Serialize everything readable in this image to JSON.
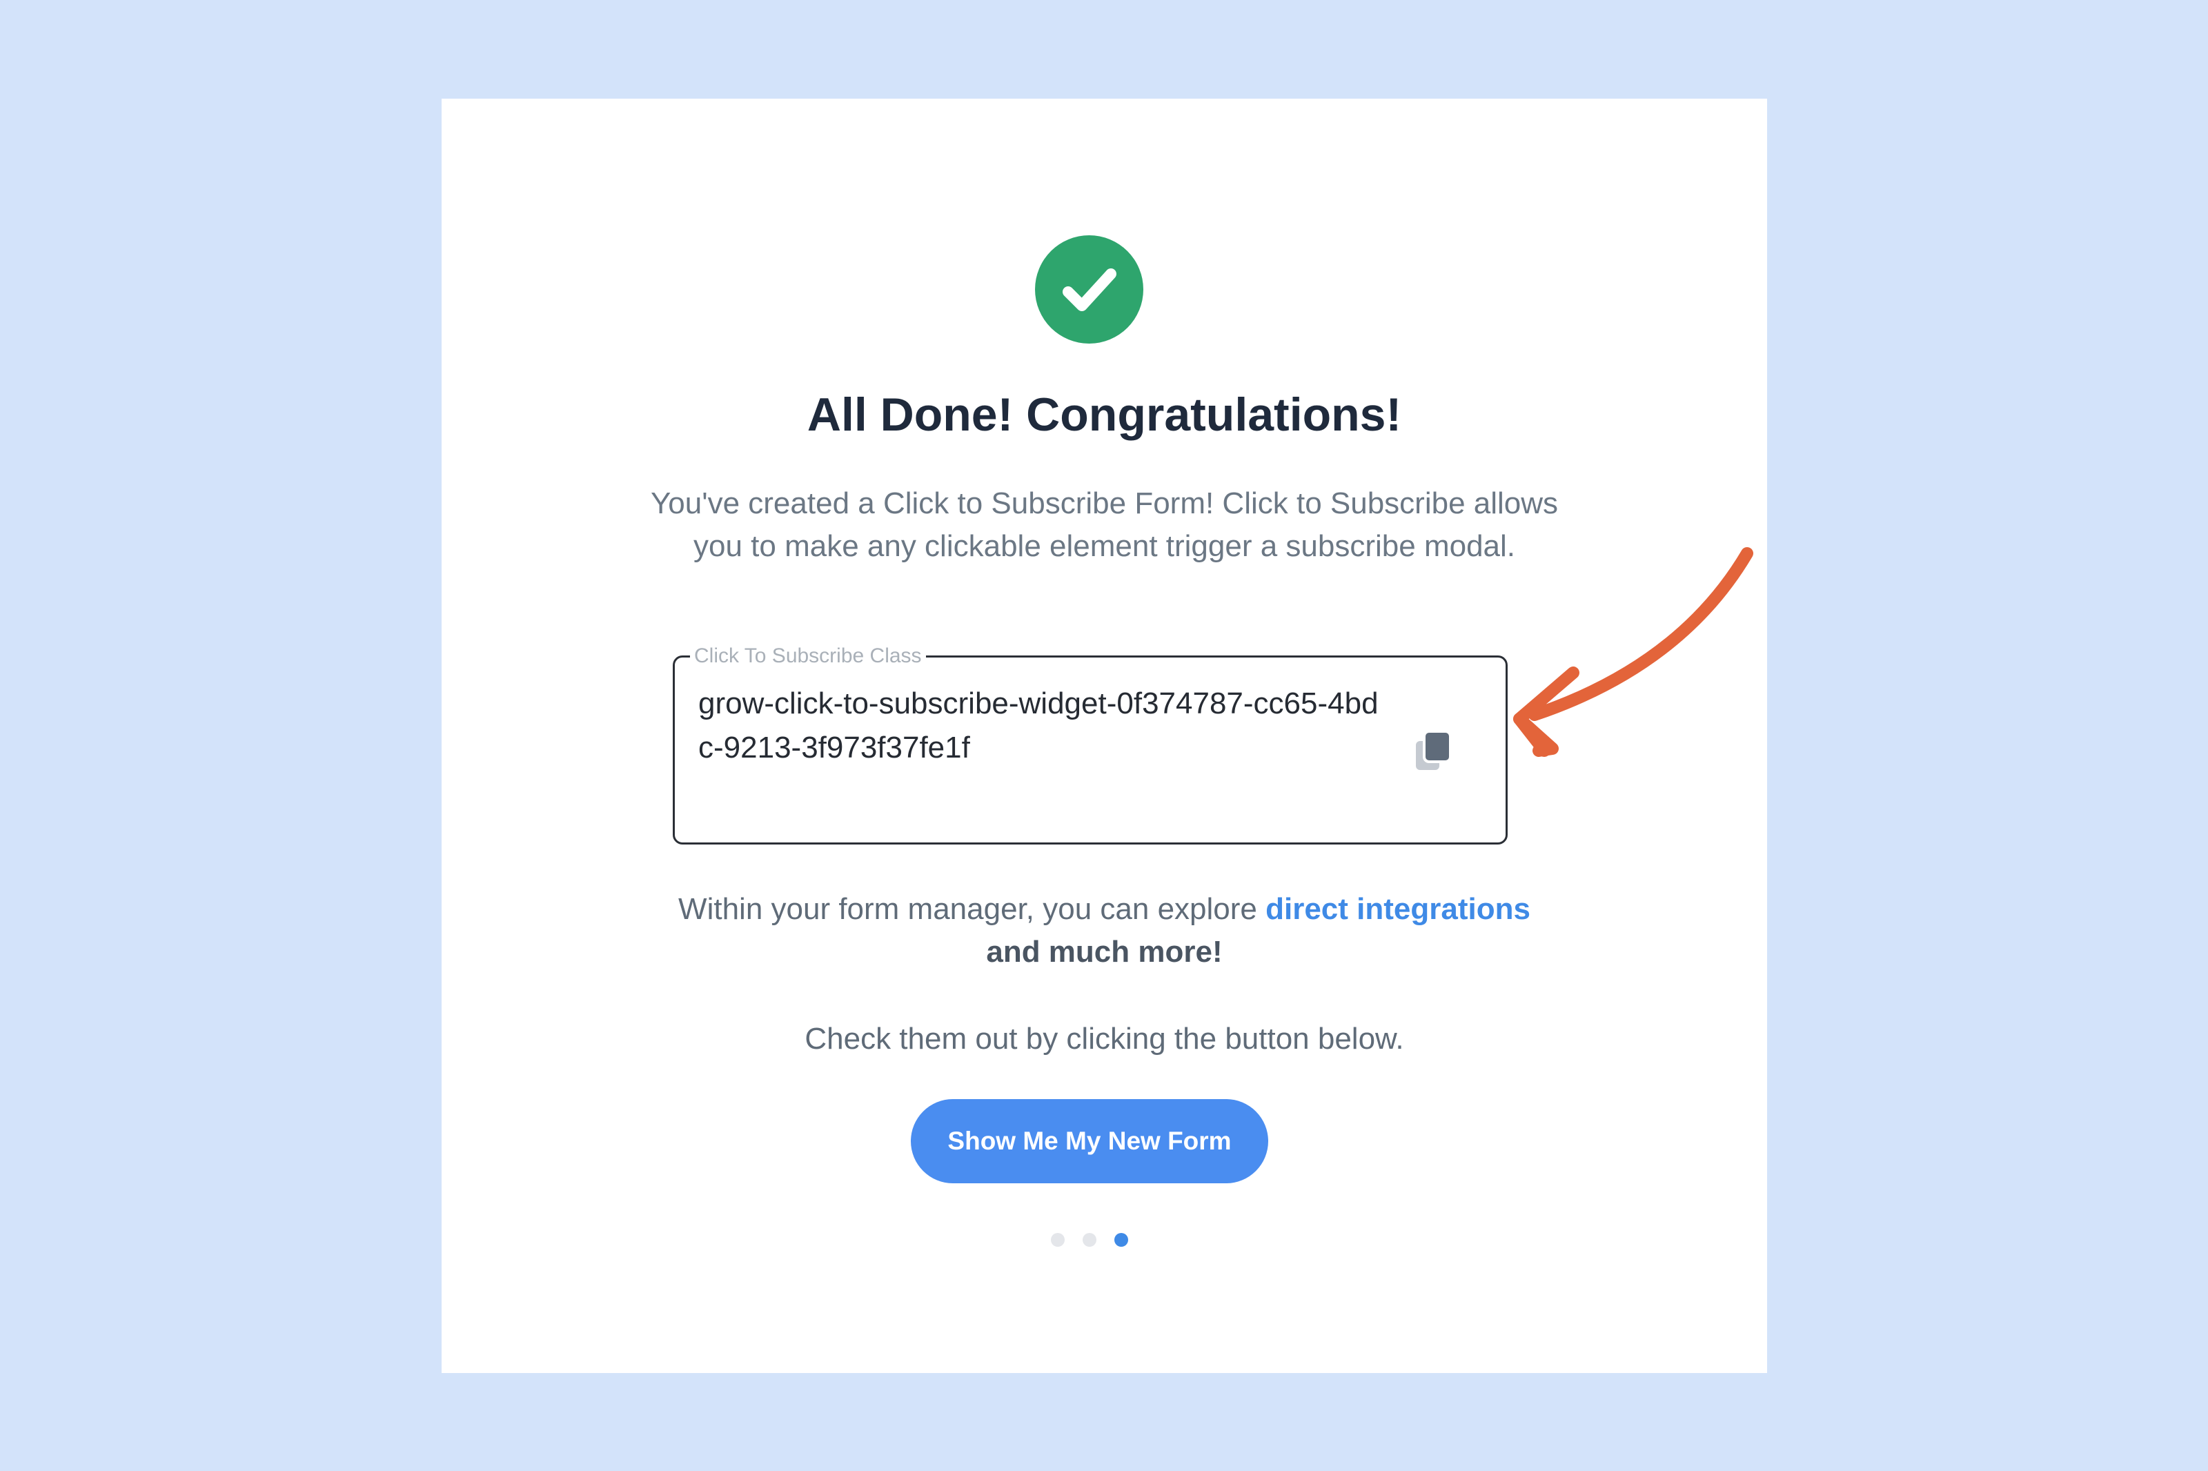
{
  "card": {
    "title": "All Done! Congratulations!",
    "description": "You've created a Click to Subscribe Form! Click to Subscribe allows you to make any clickable element trigger a subscribe modal.",
    "field": {
      "label": "Click To Subscribe Class",
      "value": "grow-click-to-subscribe-widget-0f374787-cc65-4bdc-9213-3f973f37fe1f",
      "copy_icon": "copy-icon"
    },
    "explore": {
      "prefix": "Within your form manager, you can explore ",
      "link": "direct integrations",
      "suffix": " and much more!"
    },
    "check_text": "Check them out by clicking the button below.",
    "cta_label": "Show Me My New Form",
    "pagination": {
      "total": 3,
      "active": 3
    }
  },
  "colors": {
    "background": "#d3e3fa",
    "success": "#2ea56d",
    "accent": "#4a8df0",
    "arrow": "#e3643a"
  }
}
